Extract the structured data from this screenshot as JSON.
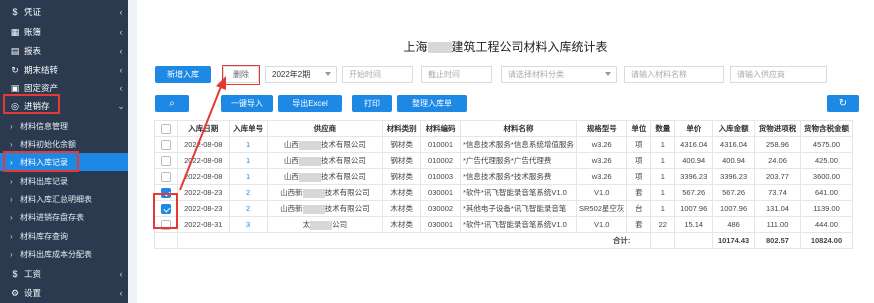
{
  "sidebar": {
    "items": [
      {
        "icon": "$",
        "icon_name": "dollar-icon",
        "label": "凭证"
      },
      {
        "icon": "▦",
        "icon_name": "ledger-icon",
        "label": "账簿"
      },
      {
        "icon": "▤",
        "icon_name": "report-icon",
        "label": "报表"
      },
      {
        "icon": "↻",
        "icon_name": "period-end-icon",
        "label": "期末结转"
      },
      {
        "icon": "▣",
        "icon_name": "asset-icon",
        "label": "固定资产"
      },
      {
        "icon": "◎",
        "icon_name": "inventory-icon",
        "label": "进销存"
      }
    ],
    "sub_items": [
      "材料信息管理",
      "材料初始化余额",
      "材料入库记录",
      "材料出库记录",
      "材料入库汇总明细表",
      "材料进销存盘存表",
      "材料库存查询",
      "材料出库成本分配表"
    ],
    "bottom_items": [
      {
        "icon": "$",
        "icon_name": "salary-icon",
        "label": "工资"
      },
      {
        "icon": "⚙",
        "icon_name": "gear-icon",
        "label": "设置"
      }
    ]
  },
  "page": {
    "title_prefix": "上海",
    "title_suffix": "建筑工程公司材料入库统计表"
  },
  "toolbar": {
    "new_btn": "新增入库",
    "delete_btn": "删除",
    "period_value": "2022年2期",
    "start_time_ph": "开始时间",
    "end_time_ph": "截止时间",
    "category_ph": "请选择材料分类",
    "material_name_ph": "请输入材料名称",
    "supplier_ph": "请输入供应商",
    "import_btn": "一键导入",
    "export_btn": "导出Excel",
    "print_btn": "打印",
    "organize_btn": "整理入库单"
  },
  "table": {
    "headers": [
      "",
      "入库日期",
      "入库单号",
      "供应商",
      "材料类别",
      "材料编码",
      "材料名称",
      "规格型号",
      "单位",
      "数量",
      "单价",
      "入库金额",
      "货物进项税",
      "货物含税金额"
    ],
    "rows": [
      {
        "checked": false,
        "date": "2022-08-08",
        "no": "1",
        "supplier_a": "山西",
        "supplier_b": "技术有限公司",
        "category": "钢材类",
        "code": "010001",
        "name": "*信息技术服务*信息系统增值服务",
        "spec": "w3.26",
        "unit": "项",
        "qty": "1",
        "price": "4316.04",
        "amount": "4316.04",
        "tax": "258.96",
        "total": "4575.00"
      },
      {
        "checked": false,
        "date": "2022-08-08",
        "no": "1",
        "supplier_a": "山西",
        "supplier_b": "技术有限公司",
        "category": "钢材类",
        "code": "010002",
        "name": "*广告代理服务*广告代理费",
        "spec": "w3.26",
        "unit": "项",
        "qty": "1",
        "price": "400.94",
        "amount": "400.94",
        "tax": "24.06",
        "total": "425.00"
      },
      {
        "checked": false,
        "date": "2022-08-08",
        "no": "1",
        "supplier_a": "山西",
        "supplier_b": "技术有限公司",
        "category": "钢材类",
        "code": "010003",
        "name": "*信息技术服务*技术服务费",
        "spec": "w3.26",
        "unit": "项",
        "qty": "1",
        "price": "3396.23",
        "amount": "3396.23",
        "tax": "203.77",
        "total": "3600.00"
      },
      {
        "checked": true,
        "date": "2022-08-23",
        "no": "2",
        "supplier_a": "山西新",
        "supplier_b": "技术有限公司",
        "category": "木材类",
        "code": "030001",
        "name": "*软件*讯飞智能录音笔系统V1.0",
        "spec": "V1.0",
        "unit": "套",
        "qty": "1",
        "price": "567.26",
        "amount": "567.26",
        "tax": "73.74",
        "total": "641.00"
      },
      {
        "checked": true,
        "date": "2022-08-23",
        "no": "2",
        "supplier_a": "山西新",
        "supplier_b": "技术有限公司",
        "category": "木材类",
        "code": "030002",
        "name": "*其他电子设备*讯飞智能录音笔",
        "spec": "SR502星空灰",
        "unit": "台",
        "qty": "1",
        "price": "1007.96",
        "amount": "1007.96",
        "tax": "131.04",
        "total": "1139.00"
      },
      {
        "checked": false,
        "date": "2022-08-31",
        "no": "3",
        "supplier_a": "太",
        "supplier_b": "公司",
        "category": "木材类",
        "code": "030001",
        "name": "*软件*讯飞智能录音笔系统V1.0",
        "spec": "V1.0",
        "unit": "套",
        "qty": "22",
        "price": "15.14",
        "amount": "486",
        "tax": "111.00",
        "total": "444.00"
      }
    ],
    "total_label": "合计:",
    "total_amount": "10174.43",
    "total_tax": "802.57",
    "total_total": "10824.00"
  },
  "colors": {
    "accent": "#1e88e5",
    "sidebar": "#2b3a4f",
    "highlight": "#e53935"
  }
}
